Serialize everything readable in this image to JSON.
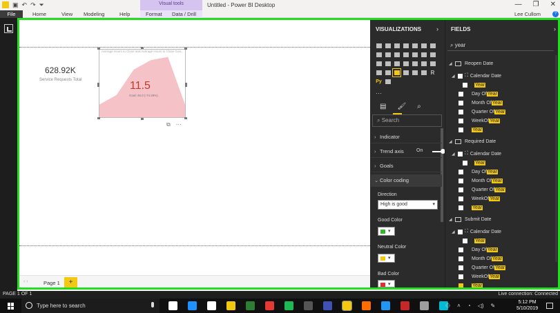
{
  "title_bar": {
    "doc_title": "Untitled - Power BI Desktop",
    "context_tab_group": "Visual tools",
    "window_buttons": [
      "—",
      "❐",
      "✕"
    ]
  },
  "ribbon": {
    "tabs": [
      "File",
      "Home",
      "View",
      "Modeling",
      "Help",
      "Format",
      "Data / Drill"
    ],
    "user": "Lee Cullom"
  },
  "canvas": {
    "card": {
      "value": "628.92K",
      "label": "Service Requests Total"
    },
    "kpi": {
      "title": "Average Hours to Close and Average Hours to Close Goa...",
      "value": "11.5",
      "goal": "Goal: 45.0 (-74.29%)",
      "trend_points": [
        0.2,
        0.35,
        0.75,
        0.9,
        0.95,
        0.2
      ],
      "fill_color": "#f4c2c7"
    },
    "page_tab": "Page 1",
    "add_page": "+"
  },
  "visualizations": {
    "header": "VISUALIZATIONS",
    "search_placeholder": "Search",
    "sections": [
      {
        "label": "Indicator",
        "expanded": false
      },
      {
        "label": "Trend axis",
        "expanded": false,
        "toggle": "On"
      },
      {
        "label": "Goals",
        "expanded": false
      },
      {
        "label": "Color coding",
        "expanded": true
      }
    ],
    "direction_label": "Direction",
    "direction_value": "High is good",
    "good_color_label": "Good Color",
    "good_color": "#2eb82e",
    "neutral_color_label": "Neutral Color",
    "neutral_color": "#f2c811",
    "bad_color_label": "Bad Color",
    "bad_color": "#e03030"
  },
  "fields": {
    "header": "FIELDS",
    "search_value": "year",
    "tables": [
      {
        "name": "Reopen Date",
        "hierarchy": "Calendar Date",
        "items": [
          {
            "pre": "",
            "hi": "Year",
            "post": ""
          },
          {
            "pre": "Day Of ",
            "hi": "Year",
            "post": ""
          },
          {
            "pre": "Month Of ",
            "hi": "Year",
            "post": ""
          },
          {
            "pre": "Quarter Of ",
            "hi": "Year",
            "post": ""
          },
          {
            "pre": "WeekOf",
            "hi": "Year",
            "post": ""
          },
          {
            "pre": "",
            "hi": "Year",
            "post": ""
          }
        ]
      },
      {
        "name": "Required Date",
        "hierarchy": "Calendar Date",
        "items": [
          {
            "pre": "",
            "hi": "Year",
            "post": ""
          },
          {
            "pre": "Day Of ",
            "hi": "Year",
            "post": ""
          },
          {
            "pre": "Month Of ",
            "hi": "Year",
            "post": ""
          },
          {
            "pre": "Quarter Of ",
            "hi": "Year",
            "post": ""
          },
          {
            "pre": "WeekOf",
            "hi": "Year",
            "post": ""
          },
          {
            "pre": "",
            "hi": "Year",
            "post": ""
          }
        ]
      },
      {
        "name": "Submit Date",
        "hierarchy": "Calendar Date",
        "items": [
          {
            "pre": "",
            "hi": "Year",
            "post": ""
          },
          {
            "pre": "Day Of ",
            "hi": "Year",
            "post": ""
          },
          {
            "pre": "Month Of ",
            "hi": "Year",
            "post": ""
          },
          {
            "pre": "Quarter Of ",
            "hi": "Year",
            "post": ""
          },
          {
            "pre": "WeekOf",
            "hi": "Year",
            "post": ""
          },
          {
            "pre": "",
            "hi": "Year",
            "post": "",
            "checked": true
          }
        ]
      }
    ]
  },
  "status_bar": {
    "page_indicator": "PAGE 1 OF 1",
    "connection": "Live connection: Connected"
  },
  "taskbar": {
    "search_placeholder": "Type here to search",
    "time": "5:12 PM",
    "date": "5/10/2019",
    "app_colors": [
      "#ffffff",
      "#1e90ff",
      "#ffffff",
      "#f2c811",
      "#2e7d32",
      "#e53935",
      "#1db954",
      "#555555",
      "#3f51b5",
      "#f2c811",
      "#ff6d00",
      "#2196f3",
      "#c62828",
      "#9e9e9e",
      "#00bcd4"
    ]
  }
}
